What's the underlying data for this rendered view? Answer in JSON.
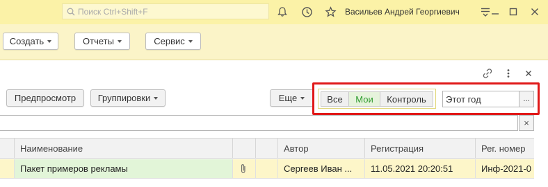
{
  "header": {
    "search_placeholder": "Поиск Ctrl+Shift+F",
    "username": "Васильев Андрей Георгиевич"
  },
  "commandbar": {
    "create_label": "Создать",
    "reports_label": "Отчеты",
    "service_label": "Сервис"
  },
  "form": {
    "preview_label": "Предпросмотр",
    "groupings_label": "Группировки",
    "more_label": "Еще",
    "filter_tabs": [
      "Все",
      "Мои",
      "Контроль"
    ],
    "active_filter": "Мои",
    "period_value": "Этот год",
    "period_button": "...",
    "clear_button": "×"
  },
  "table": {
    "columns": [
      "Наименование",
      "",
      "",
      "Автор",
      "Регистрация",
      "Рег. номер"
    ],
    "rows": [
      {
        "name": "Пакет примеров рекламы",
        "attachment_icon": "paperclip-icon",
        "author": "Сергеев Иван ...",
        "registration": "11.05.2021 20:20:51",
        "reg_number": "Инф-2021-0"
      }
    ]
  },
  "colors": {
    "titlebar": "#fbf2a7",
    "commandbar": "#fbf4c8",
    "active_tab_text": "#2d9b2d",
    "highlight": "#e01818",
    "row_selected": "#e2f5d8",
    "row_bg": "#fdf6c9"
  }
}
